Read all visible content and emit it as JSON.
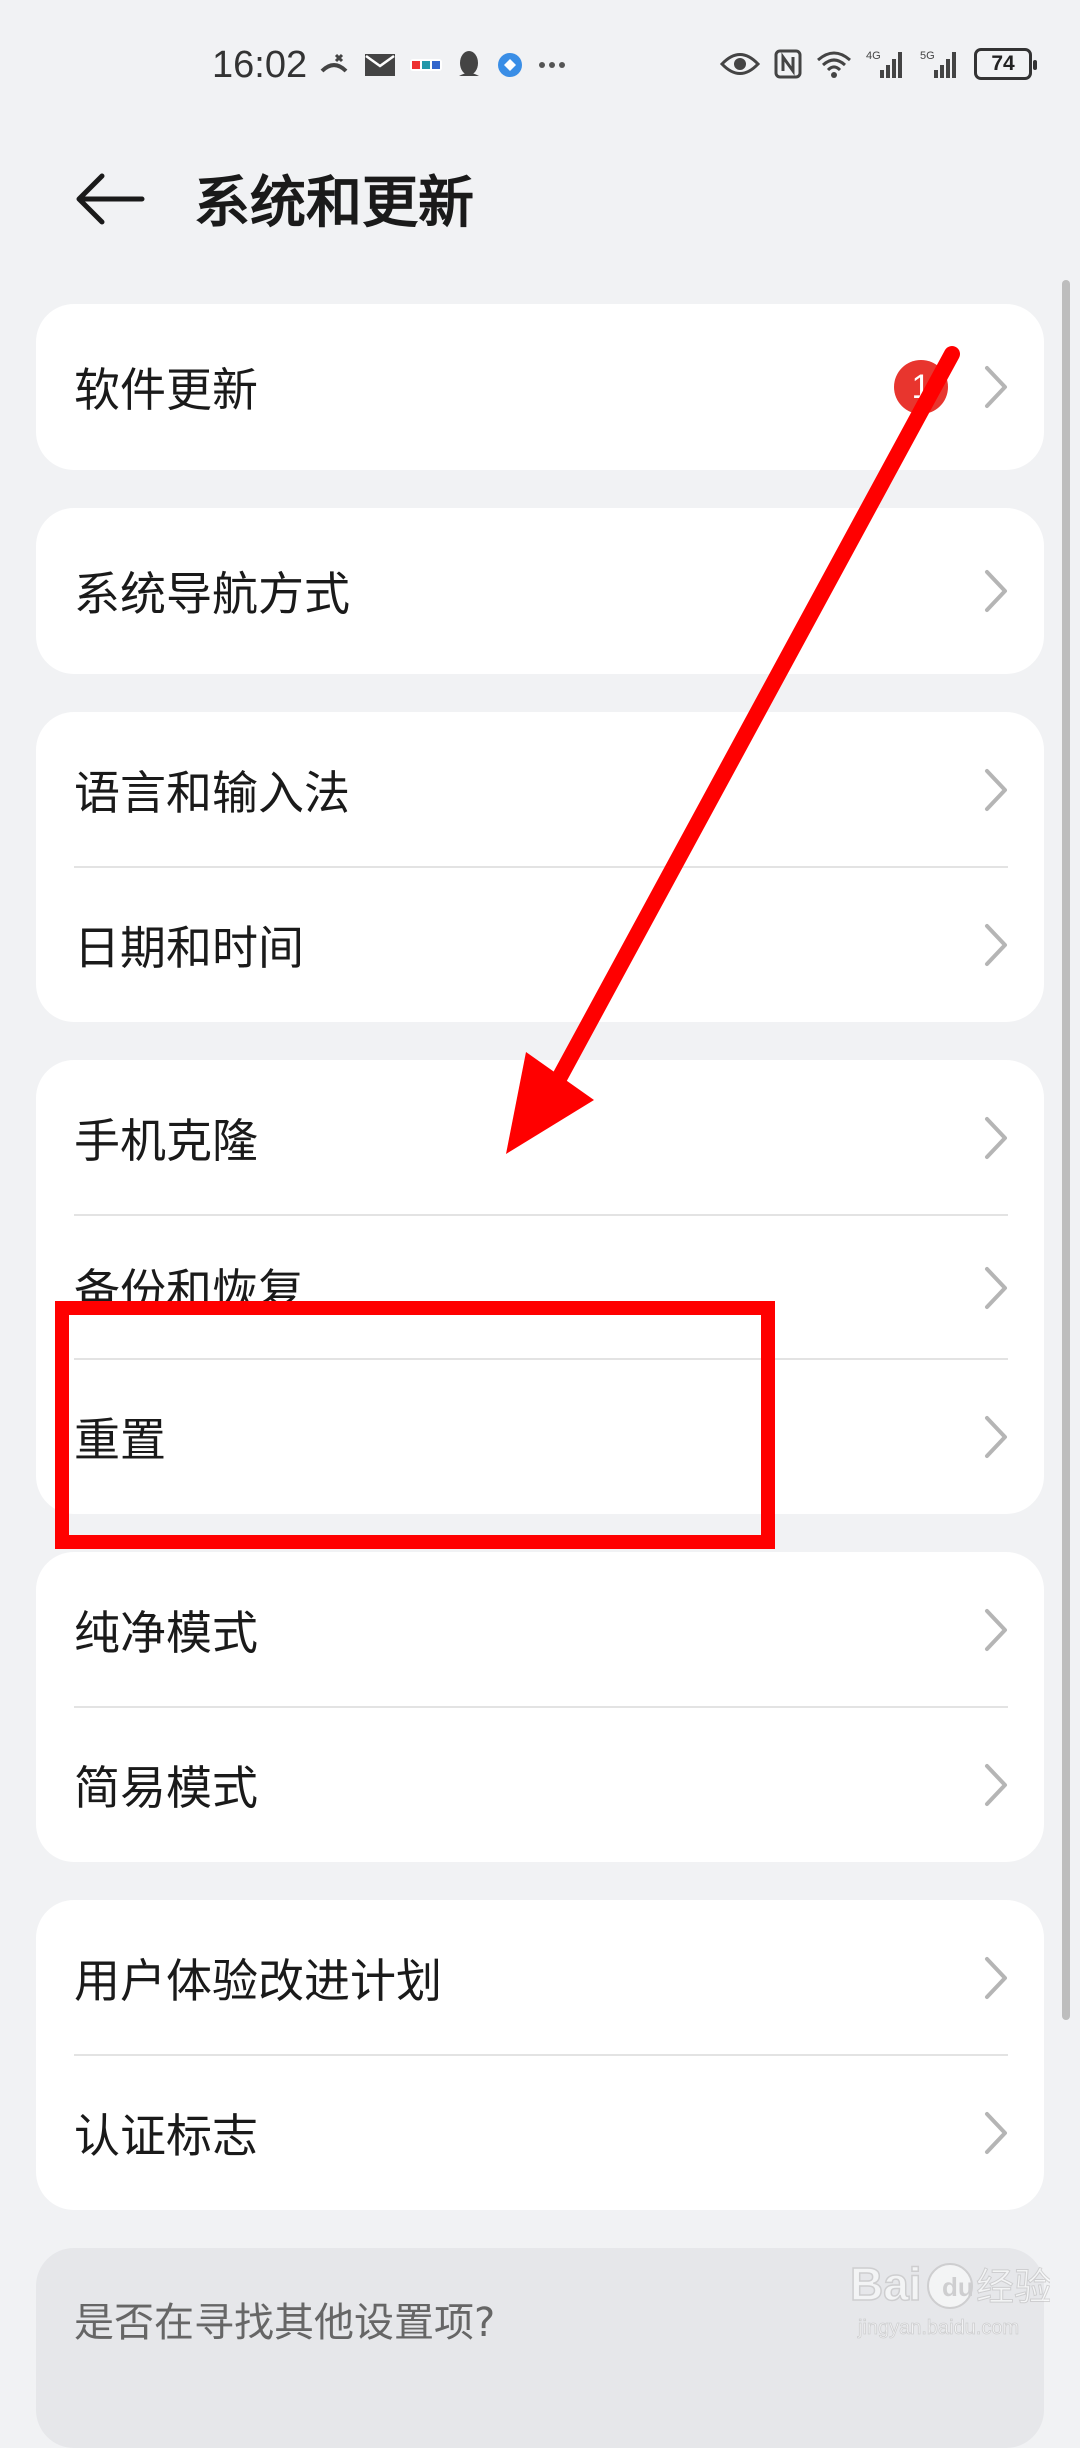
{
  "status_bar": {
    "time": "16:02",
    "battery": "74",
    "network_4g": "4G",
    "network_5g": "5G"
  },
  "header": {
    "title": "系统和更新"
  },
  "groups": [
    {
      "items": [
        {
          "label": "软件更新",
          "badge": "1"
        }
      ]
    },
    {
      "items": [
        {
          "label": "系统导航方式"
        }
      ]
    },
    {
      "items": [
        {
          "label": "语言和输入法"
        },
        {
          "label": "日期和时间"
        }
      ]
    },
    {
      "items": [
        {
          "label": "手机克隆"
        },
        {
          "label": "备份和恢复"
        },
        {
          "label": "重置"
        }
      ]
    },
    {
      "items": [
        {
          "label": "纯净模式"
        },
        {
          "label": "简易模式"
        }
      ]
    },
    {
      "items": [
        {
          "label": "用户体验改进计划"
        },
        {
          "label": "认证标志"
        }
      ]
    }
  ],
  "suggestion": {
    "text": "是否在寻找其他设置项?"
  },
  "watermark": {
    "brand": "Bai",
    "brand2": "经验",
    "url": "jingyan.baidu.com"
  },
  "colors": {
    "annotation_red": "#ff0000",
    "badge_red": "#e8352e",
    "background": "#f1f2f4"
  }
}
